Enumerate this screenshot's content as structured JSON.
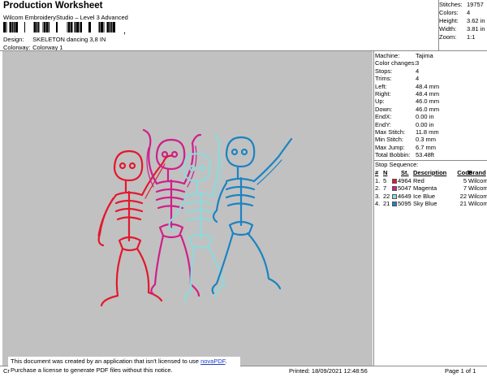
{
  "header": {
    "title": "Production Worksheet",
    "subtitle": "Wilcom EmbroideryStudio – Level 3 Advanced",
    "barcode_trailer": ","
  },
  "design": {
    "label": "Design:",
    "value": "SKELETON dancing 3,8 IN"
  },
  "colorway": {
    "label": "Colorway:",
    "value": "Colorway 1"
  },
  "top_stats": [
    {
      "label": "Stitches:",
      "value": "19757"
    },
    {
      "label": "Colors:",
      "value": "4"
    },
    {
      "label": "Height:",
      "value": "3.62 in"
    },
    {
      "label": "Width:",
      "value": "3.81 in"
    },
    {
      "label": "Zoom:",
      "value": "1:1"
    }
  ],
  "specs": [
    {
      "label": "Machine:",
      "value": "Tajima"
    },
    {
      "label": "Color changes:",
      "value": "3"
    },
    {
      "label": "Stops:",
      "value": "4"
    },
    {
      "label": "Trims:",
      "value": "4"
    },
    {
      "label": "Left:",
      "value": "48.4 mm"
    },
    {
      "label": "Right:",
      "value": "48.4 mm"
    },
    {
      "label": "Up:",
      "value": "46.0 mm"
    },
    {
      "label": "Down:",
      "value": "46.0 mm"
    },
    {
      "label": "EndX:",
      "value": "0.00 in"
    },
    {
      "label": "EndY:",
      "value": "0.00 in"
    },
    {
      "label": "Max Stitch:",
      "value": "11.8 mm"
    },
    {
      "label": "Min Stitch:",
      "value": "0.3 mm"
    },
    {
      "label": "Max Jump:",
      "value": "6.7 mm"
    },
    {
      "label": "Total Bobbin:",
      "value": "53.48ft"
    }
  ],
  "stop_sequence": {
    "title": "Stop Sequence:",
    "headers": {
      "num": "#",
      "needle": "N",
      "st": "St.",
      "description": "Description",
      "code": "Code",
      "brand": "Brand"
    },
    "rows": [
      {
        "num": "1.",
        "needle": "5",
        "color": "#e3182d",
        "code": "4964",
        "description": "Red",
        "code2": "5",
        "brand": "Wilcom"
      },
      {
        "num": "2.",
        "needle": "7",
        "color": "#cf1f8a",
        "code": "5047",
        "description": "Magenta",
        "code2": "7",
        "brand": "Wilcom"
      },
      {
        "num": "3.",
        "needle": "22",
        "color": "#8ed9dc",
        "code": "4649",
        "description": "Ice Blue",
        "code2": "22",
        "brand": "Wilcom"
      },
      {
        "num": "4.",
        "needle": "21",
        "color": "#1b83c2",
        "code": "5095",
        "description": "Sky Blue",
        "code2": "21",
        "brand": "Wilcom"
      }
    ]
  },
  "canvas": {
    "background": "#c1c1c1"
  },
  "notice": {
    "line1_prefix": "This document was created by an application that isn't licensed to use ",
    "link": "novaPDF",
    "line1_suffix": ".",
    "line2": "Purchase a license to generate PDF files without this notice."
  },
  "footer": {
    "left": "Cr",
    "printed": "Printed: 18/09/2021 12:48:56",
    "page": "Page 1 of 1"
  }
}
